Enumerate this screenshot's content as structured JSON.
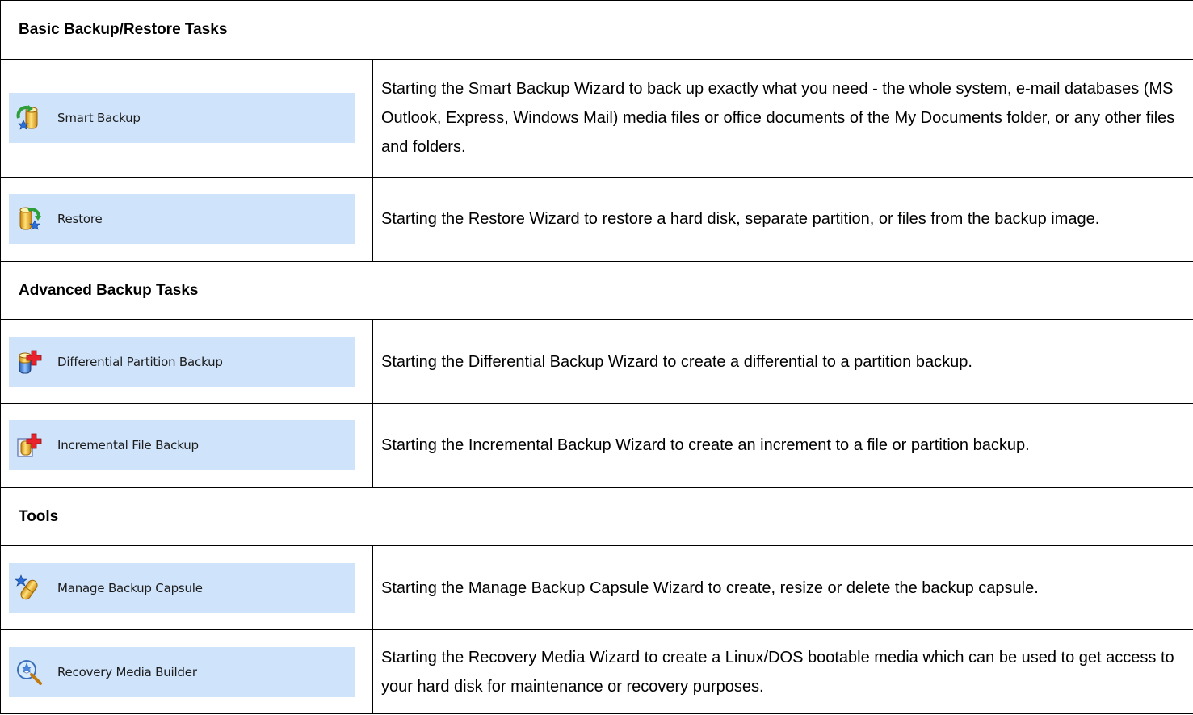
{
  "sections": [
    {
      "title": "Basic Backup/Restore Tasks",
      "tasks": [
        {
          "label": "Smart Backup",
          "icon": "smart-backup-icon",
          "description": "Starting the Smart Backup Wizard to back up exactly what you need - the whole system, e-mail databases (MS Outlook, Express, Windows Mail) media files or office documents of the My Documents folder, or any other files and folders."
        },
        {
          "label": "Restore",
          "icon": "restore-icon",
          "description": "Starting the Restore Wizard to restore a hard disk, separate partition, or files from the backup image."
        }
      ]
    },
    {
      "title": "Advanced Backup Tasks",
      "tasks": [
        {
          "label": "Differential Partition Backup",
          "icon": "differential-backup-icon",
          "description": "Starting the Differential Backup Wizard to create a differential to a partition backup."
        },
        {
          "label": "Incremental File Backup",
          "icon": "incremental-backup-icon",
          "description": "Starting the Incremental Backup Wizard to create an increment to a file or partition backup."
        }
      ]
    },
    {
      "title": "Tools",
      "tasks": [
        {
          "label": "Manage Backup Capsule",
          "icon": "backup-capsule-icon",
          "description": "Starting the Manage Backup Capsule Wizard to create, resize or delete the backup capsule."
        },
        {
          "label": "Recovery Media Builder",
          "icon": "recovery-media-icon",
          "description": "Starting the Recovery Media Wizard to create a Linux/DOS bootable media which can be used to get access to your hard disk for maintenance or recovery purposes."
        }
      ]
    }
  ],
  "colors": {
    "button_background": "#cfe3fa",
    "border": "#000000"
  }
}
